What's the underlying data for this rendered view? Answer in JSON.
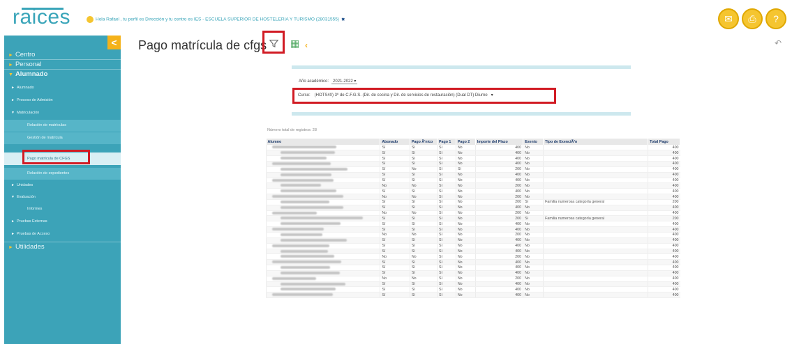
{
  "app": {
    "logo": "raices",
    "greeting": "Hola Rafael , tu perfil es Dirección y tu centro es IES - ESCUELA SUPERIOR DE HOSTELERIA Y TURISMO (28031555)",
    "close_symbol": "✖",
    "top_icons": [
      "mail-icon",
      "print-icon",
      "help-icon"
    ]
  },
  "sidebar": {
    "collapse": "<",
    "items": [
      {
        "label": "Centro",
        "level": 1
      },
      {
        "label": "Personal",
        "level": 1
      },
      {
        "label": "Alumnado",
        "level": 1,
        "bold": true
      },
      {
        "label": "Alumnado",
        "level": 2
      },
      {
        "label": "Proceso de Admisión",
        "level": 2
      },
      {
        "label": "Matriculación",
        "level": 2
      },
      {
        "label": "Relación de matrículas",
        "level": 3
      },
      {
        "label": "Gestión de matrícula",
        "level": 3
      },
      {
        "label": "Pago matrícula de CFGS",
        "level": 3,
        "selected": true
      },
      {
        "label": "Relación de expedientes",
        "level": 3
      },
      {
        "label": "Unidades",
        "level": 2
      },
      {
        "label": "Evaluación",
        "level": 2
      },
      {
        "label": "Informes",
        "level": 3
      },
      {
        "label": "Pruebas Externas",
        "level": 2
      },
      {
        "label": "Pruebas de Acceso",
        "level": 2
      },
      {
        "label": "Utilidades",
        "level": 1
      }
    ]
  },
  "main": {
    "title": "Pago matrícula de cfgs",
    "filter": {
      "year_label": "Año académico:",
      "year_value": "2021-2022",
      "course_label": "Curso:",
      "course_value": "(HOTS40) 3º de C.F.G.S. (Dir. de cocina y Dir. de servicios de restauración) (Dual DT) Diurno"
    },
    "total_label": "Número total de registros: 28",
    "table": {
      "headers": [
        "Alumno",
        "Abonado",
        "Pago Ã'nico",
        "Pago 1",
        "Pago 2",
        "Importe del Plazo",
        "Exento",
        "Tipo de ExenciÃ³n",
        "Total Pago"
      ],
      "rows": [
        [
          "",
          "Sí",
          "Sí",
          "Sí",
          "No",
          "400",
          "No",
          "",
          "400"
        ],
        [
          "",
          "Sí",
          "Sí",
          "Sí",
          "No",
          "400",
          "No",
          "",
          "400"
        ],
        [
          "",
          "Sí",
          "Sí",
          "Sí",
          "No",
          "400",
          "No",
          "",
          "400"
        ],
        [
          "",
          "Sí",
          "Sí",
          "Sí",
          "No",
          "400",
          "No",
          "",
          "400"
        ],
        [
          "",
          "Sí",
          "No",
          "Sí",
          "Sí",
          "200",
          "No",
          "",
          "400"
        ],
        [
          "",
          "Sí",
          "Sí",
          "Sí",
          "No",
          "400",
          "No",
          "",
          "400"
        ],
        [
          "",
          "Sí",
          "Sí",
          "Sí",
          "No",
          "400",
          "No",
          "",
          "400"
        ],
        [
          "",
          "No",
          "No",
          "Sí",
          "No",
          "200",
          "No",
          "",
          "400"
        ],
        [
          "",
          "Sí",
          "Sí",
          "Sí",
          "No",
          "400",
          "No",
          "",
          "400"
        ],
        [
          "",
          "No",
          "No",
          "Sí",
          "No",
          "200",
          "No",
          "",
          "400"
        ],
        [
          "",
          "Sí",
          "Sí",
          "Sí",
          "No",
          "200",
          "Sí",
          "Familia numerosa categoría general",
          "200"
        ],
        [
          "",
          "Sí",
          "Sí",
          "Sí",
          "No",
          "400",
          "No",
          "",
          "400"
        ],
        [
          "",
          "No",
          "No",
          "Sí",
          "No",
          "200",
          "No",
          "",
          "400"
        ],
        [
          "",
          "Sí",
          "Sí",
          "Sí",
          "No",
          "200",
          "Sí",
          "Familia numerosa categoría general",
          "200"
        ],
        [
          "",
          "Sí",
          "Sí",
          "Sí",
          "No",
          "400",
          "No",
          "",
          "400"
        ],
        [
          "",
          "Sí",
          "Sí",
          "Sí",
          "No",
          "400",
          "No",
          "",
          "400"
        ],
        [
          "",
          "No",
          "No",
          "Sí",
          "No",
          "200",
          "No",
          "",
          "400"
        ],
        [
          "",
          "Sí",
          "Sí",
          "Sí",
          "No",
          "400",
          "No",
          "",
          "400"
        ],
        [
          "",
          "Sí",
          "Sí",
          "Sí",
          "No",
          "400",
          "No",
          "",
          "400"
        ],
        [
          "",
          "Sí",
          "Sí",
          "Sí",
          "No",
          "400",
          "No",
          "",
          "400"
        ],
        [
          "",
          "No",
          "No",
          "Sí",
          "No",
          "200",
          "No",
          "",
          "400"
        ],
        [
          "",
          "Sí",
          "Sí",
          "Sí",
          "No",
          "400",
          "No",
          "",
          "400"
        ],
        [
          "",
          "Sí",
          "Sí",
          "Sí",
          "No",
          "400",
          "No",
          "",
          "400"
        ],
        [
          "",
          "Sí",
          "Sí",
          "Sí",
          "No",
          "400",
          "No",
          "",
          "400"
        ],
        [
          "",
          "No",
          "No",
          "Sí",
          "No",
          "200",
          "No",
          "",
          "400"
        ],
        [
          "",
          "Sí",
          "Sí",
          "Sí",
          "No",
          "400",
          "No",
          "",
          "400"
        ],
        [
          "",
          "Sí",
          "Sí",
          "Sí",
          "No",
          "400",
          "No",
          "",
          "400"
        ],
        [
          "",
          "Sí",
          "Sí",
          "Sí",
          "No",
          "400",
          "No",
          "",
          "400"
        ]
      ]
    }
  },
  "colors": {
    "sidebar": "#3ca3b8",
    "accent": "#f5b21a",
    "highlight_box": "#d11b24"
  }
}
